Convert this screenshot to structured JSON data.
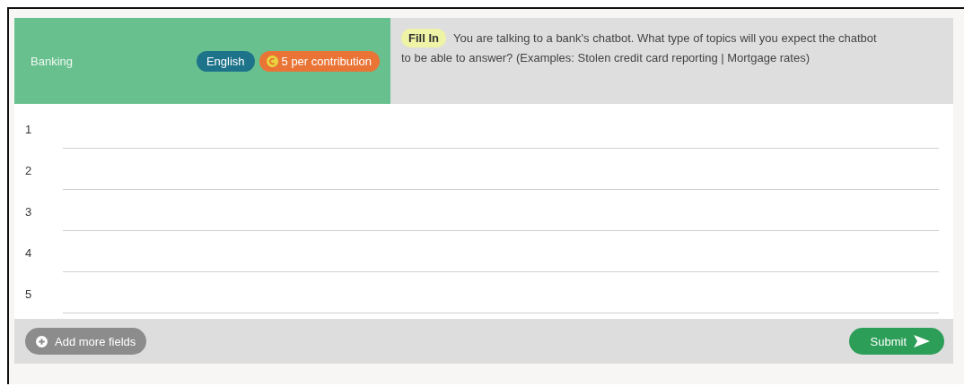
{
  "task": {
    "category": "Banking",
    "language": "English",
    "reward": "5 per contribution",
    "type_badge": "Fill In",
    "prompt": "You are talking to a bank's chatbot. What type of topics will you expect the chatbot to be able to answer? (Examples: Stolen credit card reporting | Mortgage rates)"
  },
  "fields": [
    {
      "number": "1"
    },
    {
      "number": "2"
    },
    {
      "number": "3"
    },
    {
      "number": "4"
    },
    {
      "number": "5"
    }
  ],
  "footer": {
    "add_button": "Add more fields",
    "submit_button": "Submit"
  }
}
